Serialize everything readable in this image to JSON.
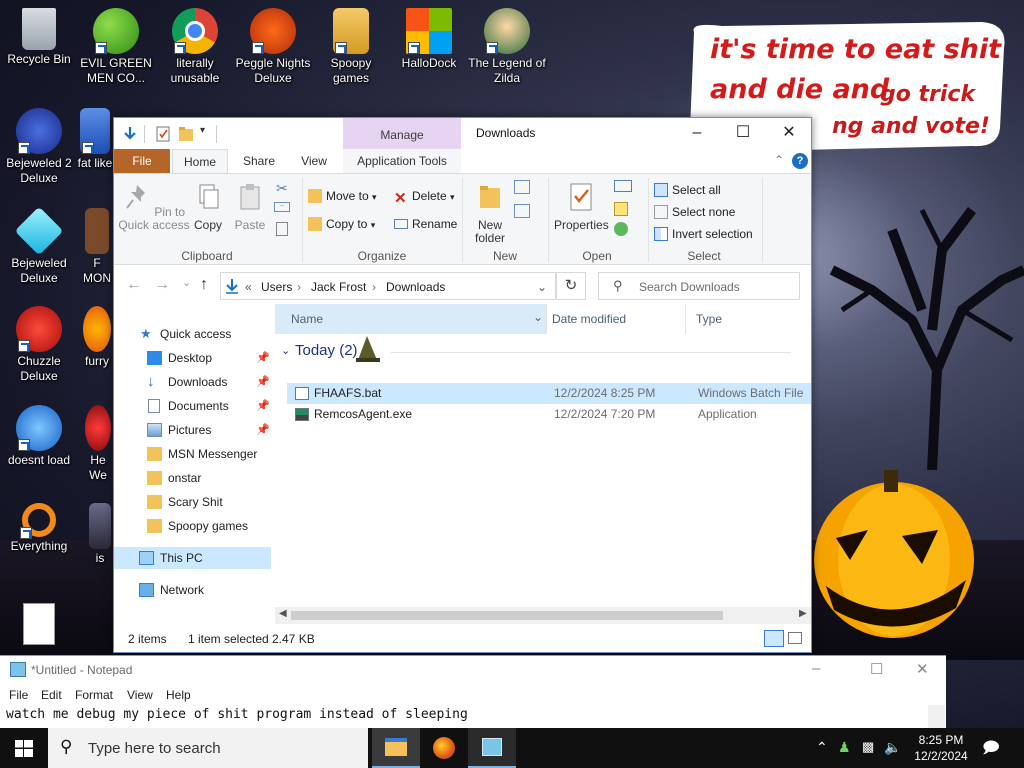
{
  "desktop": {
    "speech_bubble": {
      "line1": "it's time to eat shit",
      "line2": "and die and",
      "line2b": "go trick",
      "line3": "ng and vote!"
    },
    "icons": [
      {
        "label": "Recycle Bin"
      },
      {
        "label": "EVIL GREEN MEN CO..."
      },
      {
        "label": "literally unusable"
      },
      {
        "label": "Peggle Nights Deluxe"
      },
      {
        "label": "Spoopy games"
      },
      {
        "label": "HalloDock"
      },
      {
        "label": "The Legend of Zilda"
      },
      {
        "label": "Bejeweled 2 Deluxe"
      },
      {
        "label": "fat like"
      },
      {
        "label": "Bejeweled Deluxe"
      },
      {
        "label": "F MON"
      },
      {
        "label": "Chuzzle Deluxe"
      },
      {
        "label": "furry"
      },
      {
        "label": "doesnt load"
      },
      {
        "label": "He We"
      },
      {
        "label": "Everything"
      },
      {
        "label": "is"
      }
    ]
  },
  "explorer": {
    "title": "Downloads",
    "manage_tab": "Manage",
    "tabs": {
      "file": "File",
      "home": "Home",
      "share": "Share",
      "view": "View",
      "app_tools": "Application Tools"
    },
    "ribbon": {
      "clipboard": {
        "pin": "Pin to Quick access",
        "copy": "Copy",
        "paste": "Paste",
        "label": "Clipboard"
      },
      "organize": {
        "move_to": "Move to",
        "copy_to": "Copy to",
        "delete": "Delete",
        "rename": "Rename",
        "label": "Organize"
      },
      "new": {
        "new_folder": "New folder",
        "label": "New"
      },
      "open": {
        "properties": "Properties",
        "label": "Open"
      },
      "select": {
        "select_all": "Select all",
        "select_none": "Select none",
        "invert": "Invert selection",
        "label": "Select"
      }
    },
    "address": {
      "users": "Users",
      "user": "Jack Frost",
      "downloads": "Downloads",
      "prefix": "«"
    },
    "search_placeholder": "Search Downloads",
    "nav": {
      "quick_access": "Quick access",
      "items": [
        "Desktop",
        "Downloads",
        "Documents",
        "Pictures",
        "MSN Messenger",
        "onstar",
        "Scary Shit",
        "Spoopy games"
      ],
      "this_pc": "This PC",
      "network": "Network"
    },
    "columns": {
      "name": "Name",
      "date": "Date modified",
      "type": "Type"
    },
    "group": "Today (2)",
    "files": [
      {
        "name": "FHAAFS.bat",
        "date": "12/2/2024 8:25 PM",
        "type": "Windows Batch File",
        "selected": true
      },
      {
        "name": "RemcosAgent.exe",
        "date": "12/2/2024 7:20 PM",
        "type": "Application",
        "selected": false
      }
    ],
    "status": {
      "count": "2 items",
      "selected": "1 item selected",
      "size": "2.47 KB"
    }
  },
  "notepad": {
    "title": "*Untitled - Notepad",
    "menu": [
      "File",
      "Edit",
      "Format",
      "View",
      "Help"
    ],
    "text": "watch me debug my piece of shit program instead of sleeping"
  },
  "taskbar": {
    "search_text": "Type here to search",
    "time": "8:25 PM",
    "date": "12/2/2024"
  },
  "colors": {
    "accent": "#0078d7",
    "file_tab": "#b4662a",
    "selection": "#cce8ff",
    "manage_tab": "#e7d4f2"
  }
}
